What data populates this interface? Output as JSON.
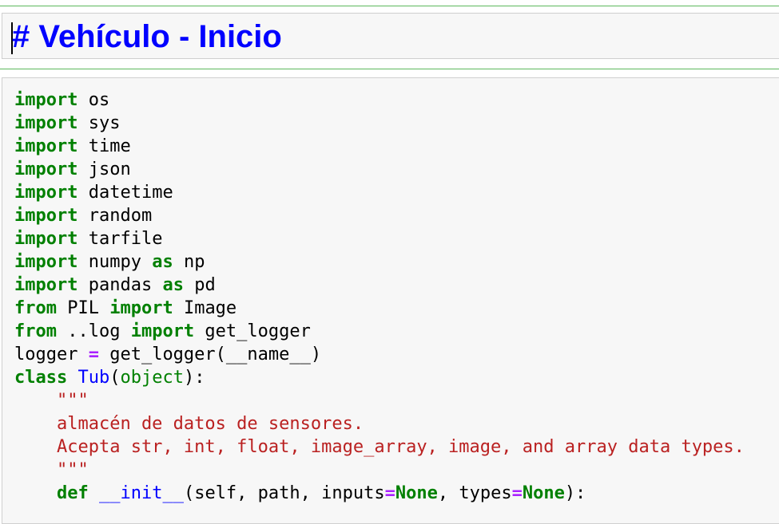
{
  "markdown_cell": {
    "heading": "# Vehículo - Inicio"
  },
  "code_cell": {
    "lines": [
      [
        {
          "t": "kw",
          "v": "import"
        },
        {
          "t": "n",
          "v": " os"
        }
      ],
      [
        {
          "t": "kw",
          "v": "import"
        },
        {
          "t": "n",
          "v": " sys"
        }
      ],
      [
        {
          "t": "kw",
          "v": "import"
        },
        {
          "t": "n",
          "v": " time"
        }
      ],
      [
        {
          "t": "kw",
          "v": "import"
        },
        {
          "t": "n",
          "v": " json"
        }
      ],
      [
        {
          "t": "kw",
          "v": "import"
        },
        {
          "t": "n",
          "v": " datetime"
        }
      ],
      [
        {
          "t": "kw",
          "v": "import"
        },
        {
          "t": "n",
          "v": " random"
        }
      ],
      [
        {
          "t": "kw",
          "v": "import"
        },
        {
          "t": "n",
          "v": " tarfile"
        }
      ],
      [
        {
          "t": "kw",
          "v": "import"
        },
        {
          "t": "n",
          "v": " numpy "
        },
        {
          "t": "kw",
          "v": "as"
        },
        {
          "t": "n",
          "v": " np"
        }
      ],
      [
        {
          "t": "kw",
          "v": "import"
        },
        {
          "t": "n",
          "v": " pandas "
        },
        {
          "t": "kw",
          "v": "as"
        },
        {
          "t": "n",
          "v": " pd"
        }
      ],
      [
        {
          "t": "kw",
          "v": "from"
        },
        {
          "t": "n",
          "v": " PIL "
        },
        {
          "t": "kw",
          "v": "import"
        },
        {
          "t": "n",
          "v": " Image"
        }
      ],
      [
        {
          "t": "kw",
          "v": "from"
        },
        {
          "t": "n",
          "v": " ..log "
        },
        {
          "t": "kw",
          "v": "import"
        },
        {
          "t": "n",
          "v": " get_logger"
        }
      ],
      [
        {
          "t": "n",
          "v": "logger "
        },
        {
          "t": "op",
          "v": "="
        },
        {
          "t": "n",
          "v": " get_logger(__name__)"
        }
      ],
      [
        {
          "t": "kw",
          "v": "class"
        },
        {
          "t": "n",
          "v": " "
        },
        {
          "t": "cls",
          "v": "Tub"
        },
        {
          "t": "n",
          "v": "("
        },
        {
          "t": "bi",
          "v": "object"
        },
        {
          "t": "n",
          "v": "):"
        }
      ],
      [
        {
          "t": "str",
          "v": "    \"\"\""
        }
      ],
      [
        {
          "t": "str",
          "v": "    almacén de datos de sensores."
        }
      ],
      [
        {
          "t": "str",
          "v": "    Acepta str, int, float, image_array, image, and array data types."
        }
      ],
      [
        {
          "t": "str",
          "v": "    \"\"\""
        }
      ],
      [
        {
          "t": "n",
          "v": "    "
        },
        {
          "t": "kw",
          "v": "def"
        },
        {
          "t": "n",
          "v": " "
        },
        {
          "t": "fn",
          "v": "__init__"
        },
        {
          "t": "n",
          "v": "(self, path, inputs"
        },
        {
          "t": "op",
          "v": "="
        },
        {
          "t": "kw",
          "v": "None"
        },
        {
          "t": "n",
          "v": ", types"
        },
        {
          "t": "op",
          "v": "="
        },
        {
          "t": "kw",
          "v": "None"
        },
        {
          "t": "n",
          "v": "):"
        }
      ]
    ]
  },
  "colors": {
    "heading": "#0000ff",
    "keyword": "#008000",
    "operator": "#aa22ff",
    "string": "#ba2121",
    "cell_border_selected": "#5cb85c",
    "cell_background": "#f7f7f7"
  }
}
